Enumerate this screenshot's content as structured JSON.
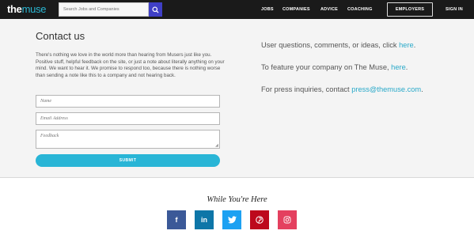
{
  "header": {
    "logo": {
      "brand_bold": "the",
      "brand_light": "muse"
    },
    "search": {
      "placeholder": "Search Jobs and Companies",
      "button_icon": "search-icon"
    },
    "nav": [
      {
        "label": "JOBS"
      },
      {
        "label": "COMPANIES"
      },
      {
        "label": "ADVICE"
      },
      {
        "label": "COACHING"
      }
    ],
    "employers_label": "EMPLOYERS",
    "signin_label": "SIGN IN"
  },
  "contact": {
    "title": "Contact us",
    "description": "There's nothing we love in the world more than hearing from Musers just like you. Positive stuff, helpful feedback on the site, or just a note about literally anything on your mind. We want to hear it. We promise to respond too, because there is nothing worse than sending a note like this to a company and not hearing back.",
    "fields": {
      "name_placeholder": "Name",
      "email_placeholder": "Email Address",
      "feedback_placeholder": "Feedback"
    },
    "submit_label": "SUBMIT"
  },
  "right": {
    "line1": {
      "text": "User questions, comments, or ideas, click ",
      "link": "here",
      "end": "."
    },
    "line2": {
      "text": "To feature your company on The Muse, ",
      "link": "here",
      "end": "."
    },
    "line3": {
      "text": "For press inquiries, contact ",
      "link": "press@themuse.com",
      "end": "."
    }
  },
  "footer": {
    "while_title": "While You're Here",
    "social": [
      {
        "icon": "facebook-icon",
        "glyph": "f",
        "color": "#3b5998"
      },
      {
        "icon": "linkedin-icon",
        "glyph": "in",
        "color": "#0e76a8"
      },
      {
        "icon": "twitter-icon",
        "glyph": "t",
        "color": "#1da1f2"
      },
      {
        "icon": "pinterest-icon",
        "glyph": "p",
        "color": "#bd081c"
      },
      {
        "icon": "instagram-icon",
        "glyph": "ig",
        "color": "#e4405f"
      }
    ]
  },
  "colors": {
    "header_bg": "#1a1a1a",
    "accent": "#29b5d6",
    "search_button": "#3f3fc6",
    "band_bg": "#f4f4f4"
  }
}
